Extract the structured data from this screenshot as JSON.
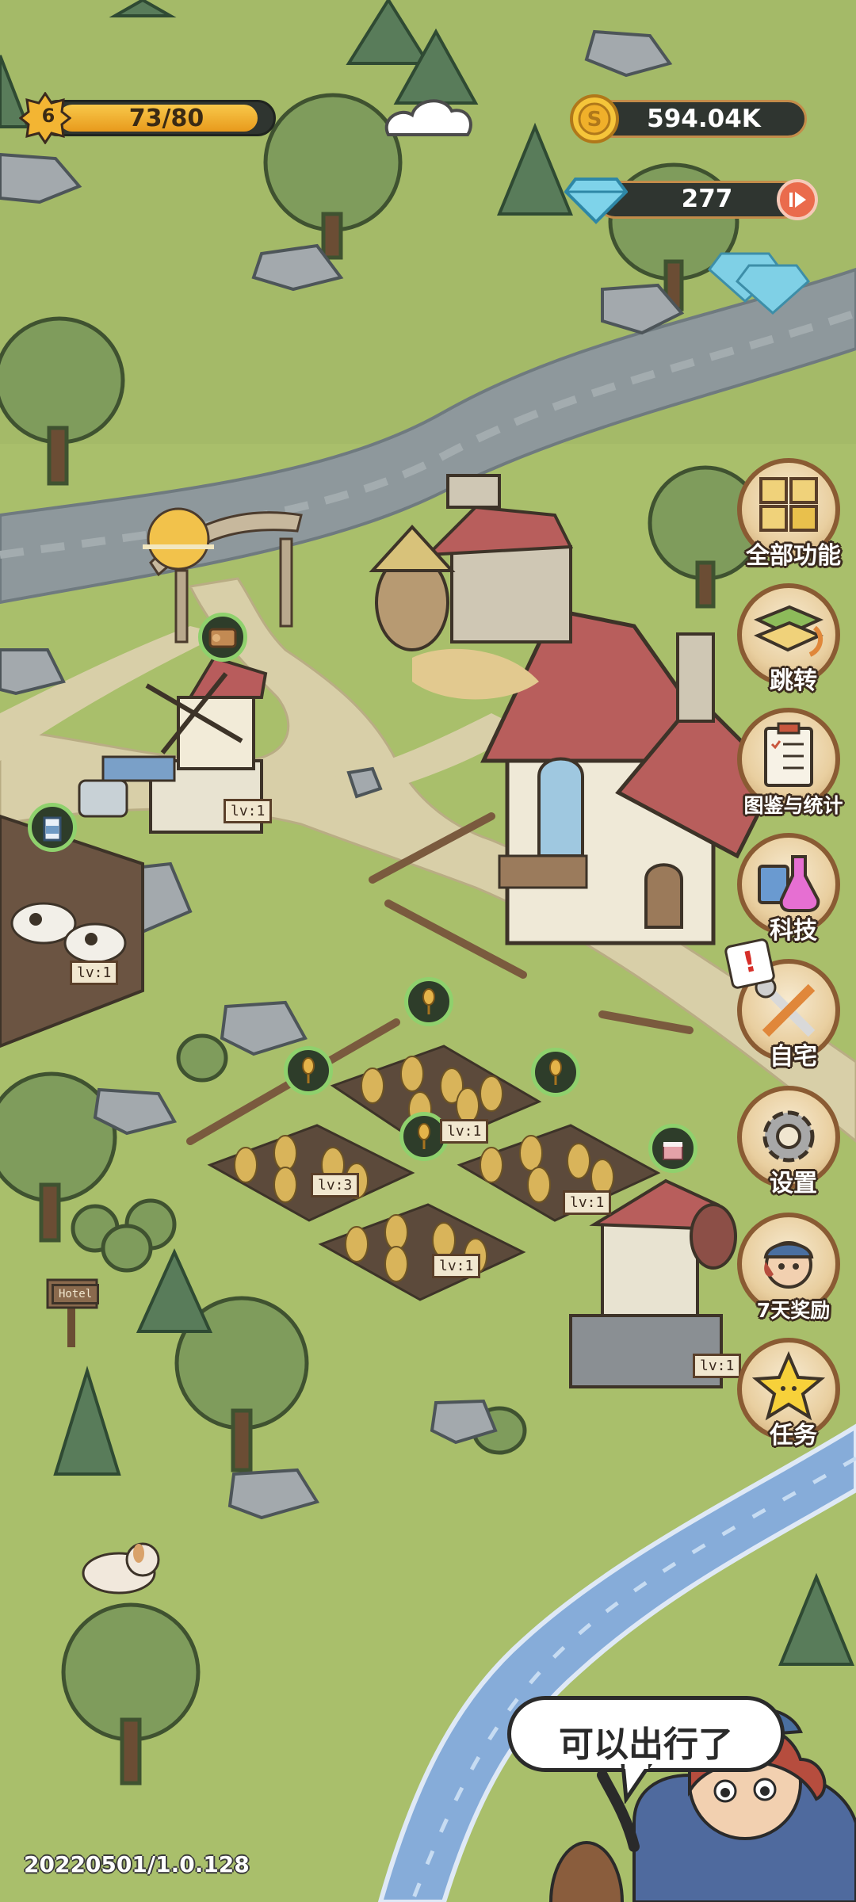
{
  "hud": {
    "level": "6",
    "energy": "73/80",
    "energy_fraction": 0.91,
    "coins": "594.04K",
    "gems": "277"
  },
  "menu": [
    {
      "id": "all-functions",
      "label": "全部功能",
      "icon": "boxes-icon"
    },
    {
      "id": "jump",
      "label": "跳转",
      "icon": "map-icon"
    },
    {
      "id": "collection-stats",
      "label": "图鉴与统计",
      "icon": "clipboard-icon"
    },
    {
      "id": "tech",
      "label": "科技",
      "icon": "potion-icon"
    },
    {
      "id": "home",
      "label": "自宅",
      "icon": "tools-icon"
    },
    {
      "id": "settings",
      "label": "设置",
      "icon": "gear-icon"
    },
    {
      "id": "seven-day-reward",
      "label": "7天奖励",
      "icon": "character-icon"
    },
    {
      "id": "tasks",
      "label": "任务",
      "icon": "star-icon"
    }
  ],
  "signs": {
    "windmill": "lv:1",
    "pen": "lv:1",
    "field_top": "lv:1",
    "field_left": "lv:3",
    "field_right": "lv:1",
    "field_bottom": "lv:1",
    "kitchen": "lv:1",
    "hotel": "Hotel"
  },
  "speech_bubble": "可以出行了",
  "version": "20220501/1.0.128",
  "colors": {
    "grass": "#a7bd6a",
    "river": "#8f9aa0",
    "stream": "#7fa7d8",
    "path": "#d9cfa9",
    "energy_fill": "#f3b533",
    "hud_dark": "#2f3530"
  }
}
